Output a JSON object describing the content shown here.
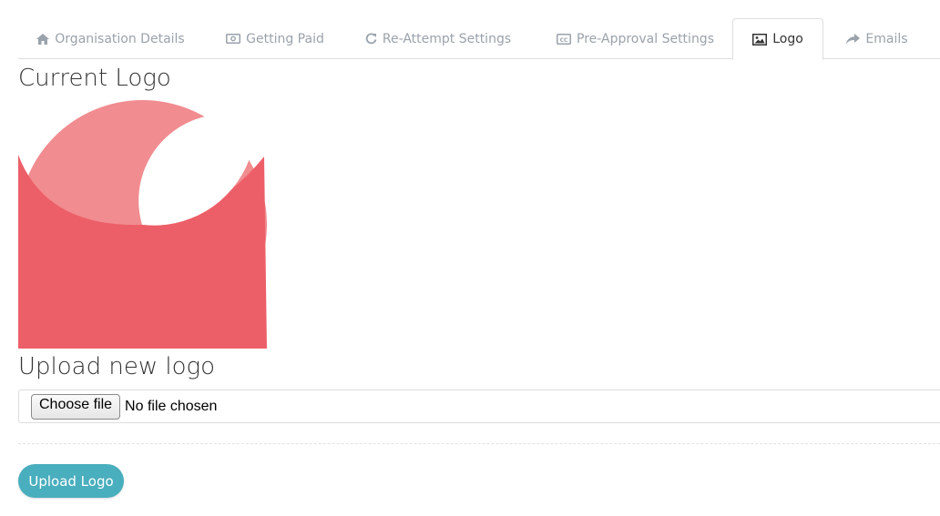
{
  "tabs": [
    {
      "label": "Organisation Details",
      "icon": "home-icon"
    },
    {
      "label": "Getting Paid",
      "icon": "money-icon"
    },
    {
      "label": "Re-Attempt Settings",
      "icon": "refresh-icon"
    },
    {
      "label": "Pre-Approval Settings",
      "icon": "credit-card-icon"
    },
    {
      "label": "Logo",
      "icon": "image-icon",
      "active": true
    },
    {
      "label": "Emails",
      "icon": "share-icon"
    }
  ],
  "current_logo": {
    "heading": "Current Logo",
    "colors": {
      "primary": "#ed5f68",
      "secondary": "#f18c90"
    }
  },
  "upload": {
    "heading": "Upload new logo",
    "choose_label": "Choose file",
    "file_status": "No file chosen",
    "button_label": "Upload Logo",
    "button_color": "#49aebd"
  }
}
